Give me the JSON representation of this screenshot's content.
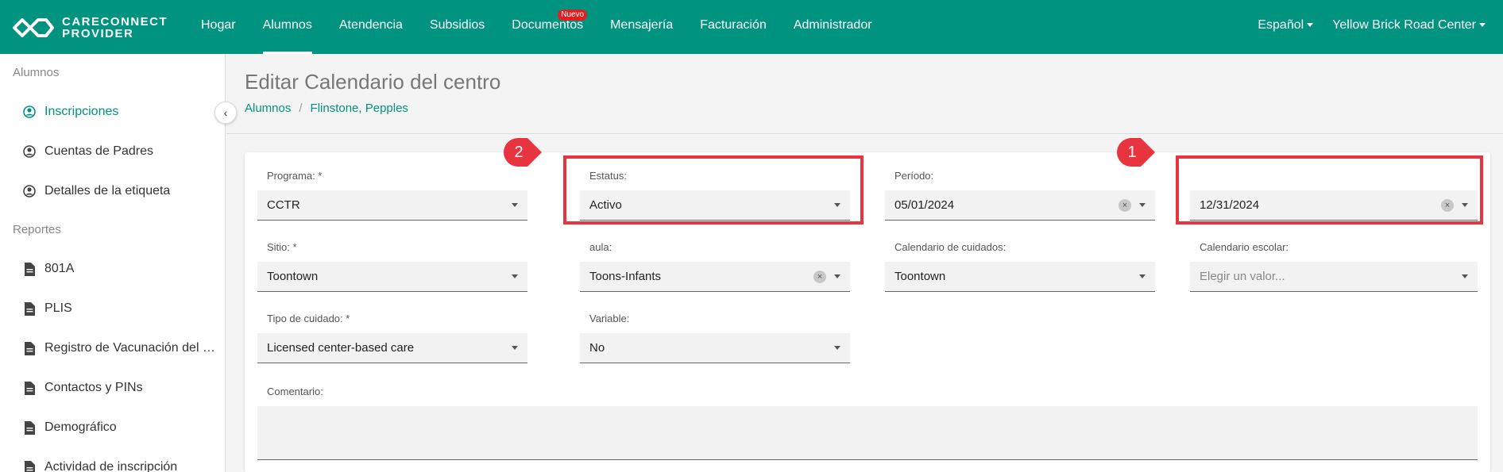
{
  "brand": {
    "line1": "CARECONNECT",
    "line2": "PROVIDER"
  },
  "nav": {
    "items": [
      "Hogar",
      "Alumnos",
      "Atendencia",
      "Subsidios",
      "Documentos",
      "Mensajería",
      "Facturación",
      "Administrador"
    ],
    "active": "Alumnos",
    "documentos_badge": "Nuevo",
    "language": "Español",
    "center": "Yellow Brick Road Center"
  },
  "sidebar": {
    "section_alumnos": "Alumnos",
    "alumnos_items": [
      "Inscripciones",
      "Cuentas de Padres",
      "Detalles de la etiqueta"
    ],
    "section_reportes": "Reportes",
    "reportes_items": [
      "801A",
      "PLIS",
      "Registro de Vacunación del …",
      "Contactos y PINs",
      "Demográfico",
      "Actividad de inscripción"
    ]
  },
  "page": {
    "title": "Editar Calendario del centro",
    "breadcrumb": [
      "Alumnos",
      "Flinstone, Pepples"
    ]
  },
  "form": {
    "programa": {
      "label": "Programa: *",
      "value": "CCTR"
    },
    "estatus": {
      "label": "Estatus:",
      "value": "Activo"
    },
    "periodo": {
      "label": "Período:",
      "start": "05/01/2024",
      "end": "12/31/2024"
    },
    "sitio": {
      "label": "Sitio: *",
      "value": "Toontown"
    },
    "aula": {
      "label": "aula:",
      "value": "Toons-Infants"
    },
    "calendario_cuidados": {
      "label": "Calendario de cuidados:",
      "value": "Toontown"
    },
    "calendario_escolar": {
      "label": "Calendario escolar:",
      "placeholder": "Elegir un valor..."
    },
    "tipo_cuidado": {
      "label": "Tipo de cuidado: *",
      "value": "Licensed center-based care"
    },
    "variable": {
      "label": "Variable:",
      "value": "No"
    },
    "comentario": {
      "label": "Comentario:"
    }
  },
  "annotations": {
    "marker1": "1",
    "marker2": "2",
    "color": "#e8343f"
  },
  "colors": {
    "primary": "#00937f",
    "badge": "#e02020"
  }
}
